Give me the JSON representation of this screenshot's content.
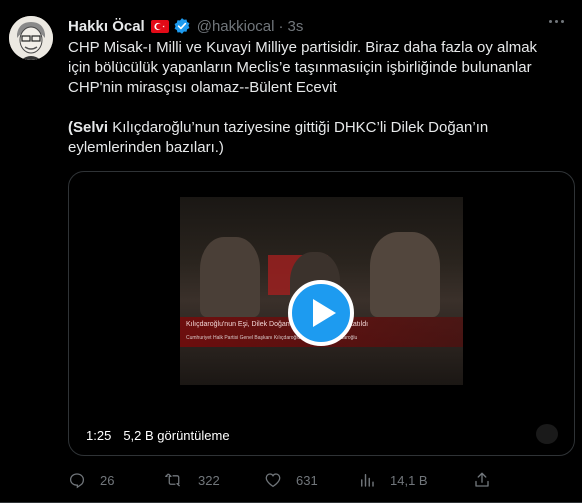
{
  "author": {
    "name": "Hakkı Öcal",
    "handle": "@hakkiocal",
    "separator": "·",
    "time": "3s",
    "flag_icon": "turkey-flag-icon",
    "verified_icon": "verified-badge-icon"
  },
  "body": {
    "line1": "CHP Misak-ı Milli ve Kuvayi Milliye partisidir. Biraz daha fazla oy almak",
    "line2": "için bölücülük yapanların Meclis’e taşınmasıiçin işbirliğinde bulunanlar",
    "line3": "CHP'nin  mirasçısı olamaz--Bülent Ecevit",
    "para2_open": "(",
    "para2_bold": "Selvi",
    "para2_rest1": " Kılıçdaroğlu’nun taziyesine gittiği DHKC’li Dilek Doğan’ın",
    "para2_line2": "eylemlerinden bazıları.)"
  },
  "video": {
    "duration": "1:25",
    "views": "5,2 B görüntüleme",
    "overlay_title": "Kılıçdaroğlu'nun Eşi, Dilek Doğan'ın Ailesine Ziyaret Katıldı",
    "overlay_sub": "Cumhuriyet Halk Partisi Genel Başkanı Kılıçdaroğlu'nun eşi Selvi Kılıçdaroğlu",
    "play_icon": "play-icon"
  },
  "actions": {
    "replies": "26",
    "retweets": "322",
    "likes": "631",
    "views": "14,1 B"
  },
  "colors": {
    "background": "#000000",
    "text": "#e7e9ea",
    "muted": "#71767b",
    "accent": "#1d9bf0",
    "flag_red": "#e30a17"
  }
}
